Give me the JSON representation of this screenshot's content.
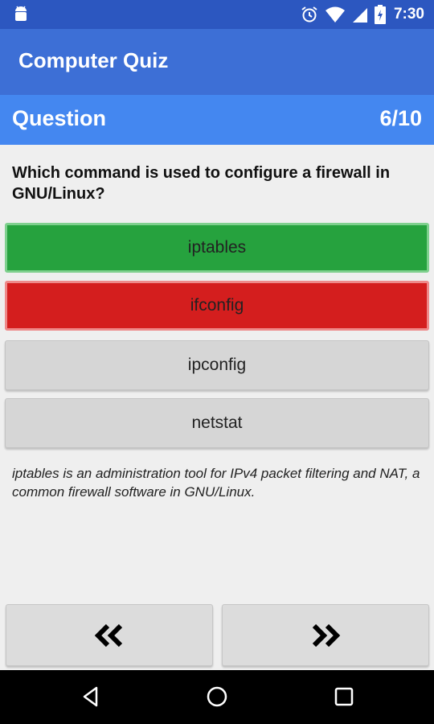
{
  "status_bar": {
    "time": "7:30",
    "icons": [
      "android-debug-icon",
      "alarm-icon",
      "wifi-icon",
      "signal-icon",
      "battery-charging-icon"
    ]
  },
  "app": {
    "title": "Computer Quiz"
  },
  "question_header": {
    "label": "Question",
    "counter": "6/10"
  },
  "question": {
    "text": "Which command is used to configure a firewall in GNU/Linux?"
  },
  "answers": [
    {
      "label": "iptables",
      "state": "correct",
      "color": "#26a23e"
    },
    {
      "label": "ifconfig",
      "state": "wrong",
      "color": "#d41e1e"
    },
    {
      "label": "ipconfig",
      "state": "neutral",
      "color": "#d6d6d6"
    },
    {
      "label": "netstat",
      "state": "neutral",
      "color": "#d6d6d6"
    }
  ],
  "explanation": "iptables is an administration tool for IPv4 packet filtering and NAT, a common firewall software in GNU/Linux.",
  "navigation": {
    "prev_icon": "double-chevron-left-icon",
    "next_icon": "double-chevron-right-icon"
  },
  "system_nav": [
    "back-icon",
    "home-icon",
    "recents-icon"
  ],
  "colors": {
    "status_bar": "#2c57c0",
    "app_bar": "#3d6fd6",
    "question_header": "#4487f0",
    "background": "#efefef"
  }
}
